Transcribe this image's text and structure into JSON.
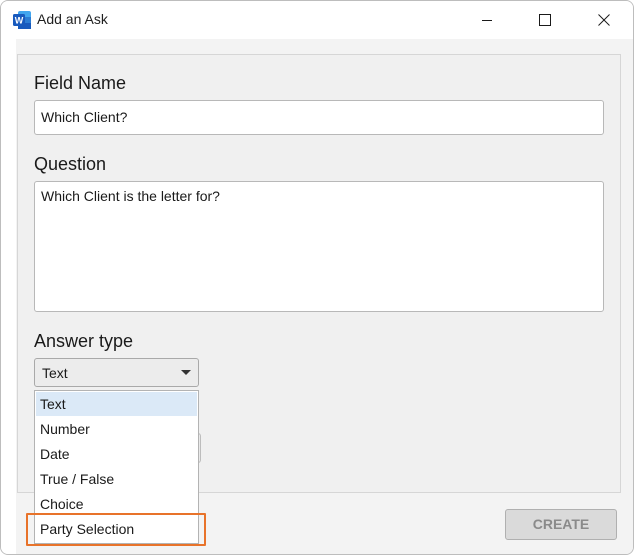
{
  "window": {
    "title": "Add an Ask",
    "app_icon_letter": "W"
  },
  "form": {
    "field_name_label": "Field Name",
    "field_name_value": "Which Client?",
    "question_label": "Question",
    "question_value": "Which Client is the letter for?",
    "answer_type_label": "Answer type",
    "answer_type_selected": "Text"
  },
  "dropdown": {
    "options": [
      "Text",
      "Number",
      "Date",
      "True / False",
      "Choice",
      "Party Selection"
    ]
  },
  "actions": {
    "create_label": "CREATE"
  },
  "colors": {
    "highlight": "#e8732a",
    "selected_option": "#dbe9f7",
    "word_blue": "#185abd"
  }
}
